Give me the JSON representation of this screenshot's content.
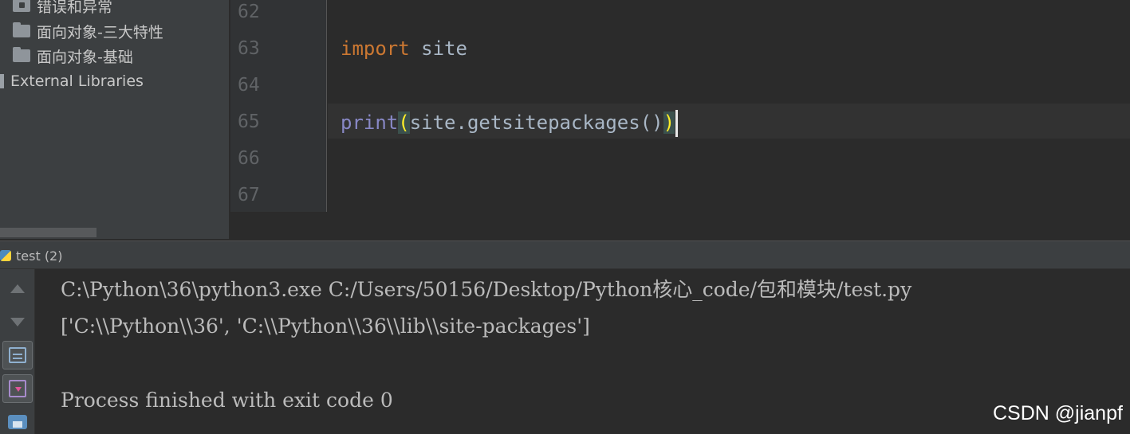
{
  "project_tree": {
    "items": [
      {
        "label": "错误和异常",
        "icon": "package-folder-icon"
      },
      {
        "label": "面向对象-三大特性",
        "icon": "folder-icon"
      },
      {
        "label": "面向对象-基础",
        "icon": "folder-icon"
      }
    ],
    "external_libraries": "External Libraries"
  },
  "editor": {
    "line_numbers": [
      "62",
      "63",
      "64",
      "65",
      "66",
      "67"
    ],
    "line63": {
      "keyword": "import",
      "rest": " site"
    },
    "line65": {
      "builtin": "print",
      "open_paren": "(",
      "body": "site.getsitepackages()",
      "close_paren": ")"
    }
  },
  "run_panel": {
    "tab_label": "test (2)",
    "toolbar_icons": [
      "up-arrow-icon",
      "down-arrow-icon",
      "soft-wrap-icon",
      "scroll-to-end-icon",
      "print-icon"
    ],
    "console": {
      "command": "C:\\Python\\36\\python3.exe C:/Users/50156/Desktop/Python核心_code/包和模块/test.py",
      "output": "['C:\\\\Python\\\\36', 'C:\\\\Python\\\\36\\\\lib\\\\site-packages']",
      "exit_message": "Process finished with exit code 0"
    }
  },
  "watermark": "CSDN @jianpf",
  "colors": {
    "editor_bg": "#2b2b2b",
    "panel_bg": "#3c3f41",
    "keyword": "#cc7832",
    "builtin": "#8888c6",
    "text": "#a9b7c6",
    "paren_highlight_fg": "#ffef28"
  }
}
